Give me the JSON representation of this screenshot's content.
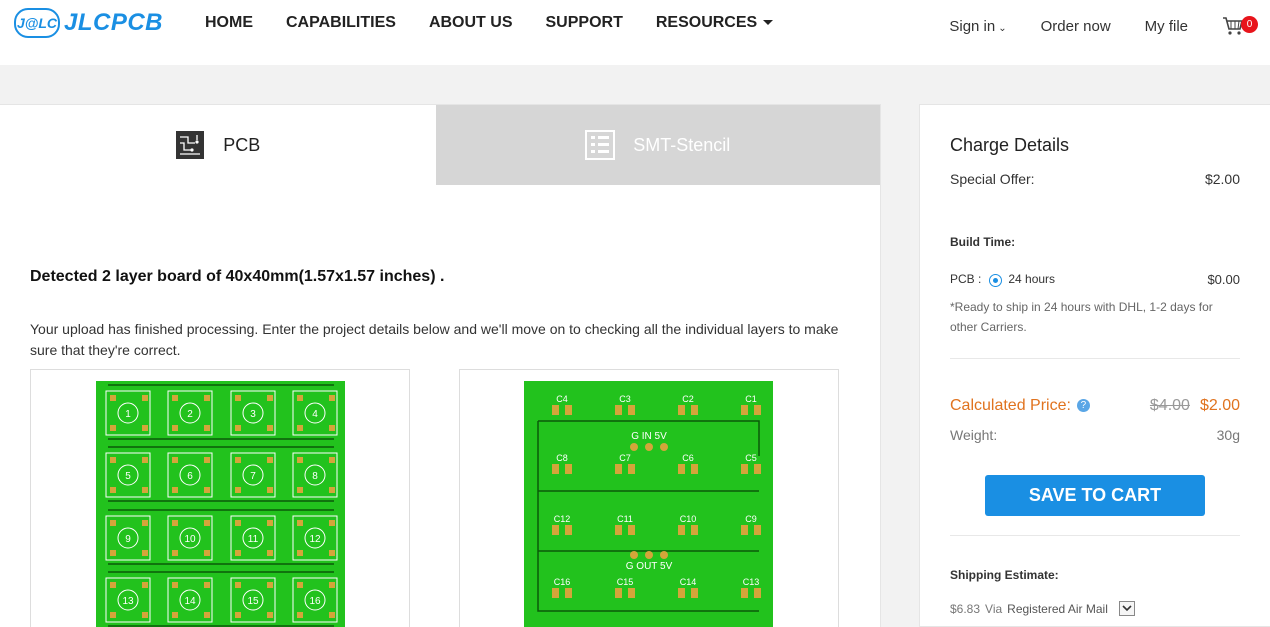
{
  "header": {
    "logo_badge": "J@LC",
    "logo_text": "JLCPCB",
    "menu": [
      "HOME",
      "CAPABILITIES",
      "ABOUT US",
      "SUPPORT",
      "RESOURCES"
    ],
    "sign_in": "Sign in",
    "order_now": "Order now",
    "my_file": "My file",
    "cart_count": "0"
  },
  "tabs": {
    "pcb": "PCB",
    "smt": "SMT-Stencil"
  },
  "main": {
    "detected": "Detected 2 layer board of 40x40mm(1.57x1.57 inches) .",
    "upload_msg": "Your upload has finished processing. Enter the project details below and we'll move on to checking all the individual layers to make sure that they're correct."
  },
  "preview_top": {
    "pad_labels": [
      "1",
      "2",
      "3",
      "4",
      "5",
      "6",
      "7",
      "8",
      "9",
      "10",
      "11",
      "12",
      "13",
      "14",
      "15",
      "16"
    ]
  },
  "preview_bottom": {
    "cap_labels": [
      "C4",
      "C3",
      "C2",
      "C1",
      "C8",
      "C7",
      "C6",
      "C5",
      "C12",
      "C11",
      "C10",
      "C9",
      "C16",
      "C15",
      "C14",
      "C13"
    ],
    "label_in": "G IN 5V",
    "label_out": "G OUT 5V"
  },
  "charge": {
    "title": "Charge Details",
    "special_offer_label": "Special Offer:",
    "special_offer_value": "$2.00",
    "build_time_label": "Build Time:",
    "pcb_label": "PCB :",
    "pcb_option": "24 hours",
    "pcb_price": "$0.00",
    "note": "*Ready to ship in 24 hours with DHL, 1-2 days for other Carriers.",
    "calc_label": "Calculated Price:",
    "old_price": "$4.00",
    "new_price": "$2.00",
    "weight_label": "Weight:",
    "weight_value": "30g",
    "save_to_cart": "SAVE TO CART",
    "shipping_label": "Shipping Estimate:",
    "ship_price": "$6.83",
    "ship_via": "Via",
    "ship_method": "Registered Air Mail"
  },
  "colors": {
    "brand_blue": "#1a8fe3",
    "price_orange": "#e0731f",
    "pcb_green": "#22c21d"
  }
}
